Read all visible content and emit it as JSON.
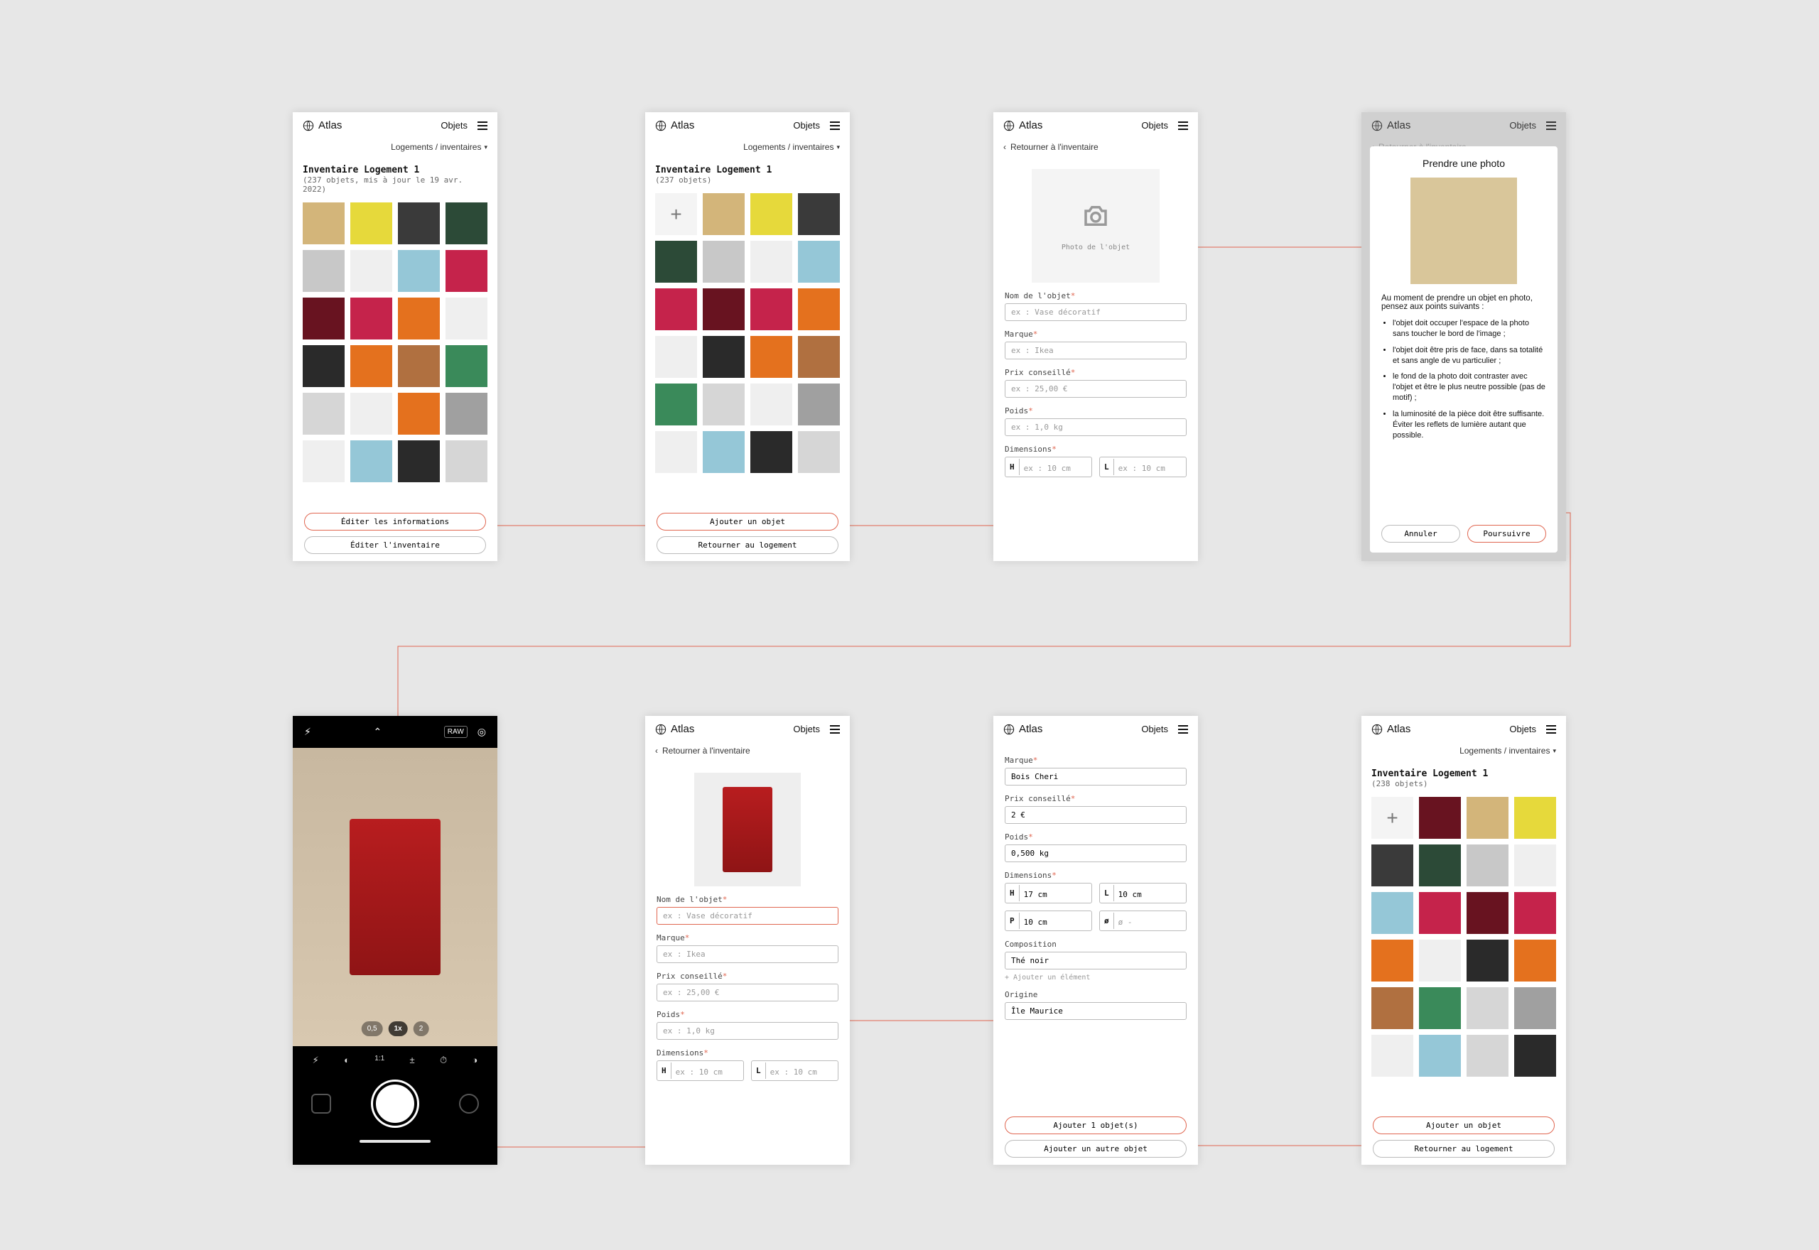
{
  "brand": "Atlas",
  "header": {
    "objets": "Objets",
    "breadcrumb": "Logements / inventaires",
    "breadcrumb_symbol": "▾"
  },
  "back_label": "Retourner à l'inventaire",
  "screen1": {
    "title": "Inventaire Logement 1",
    "subtitle": "(237 objets, mis à jour le 19 avr. 2022)",
    "btn_edit_info": "Éditer les informations",
    "btn_edit_inv": "Éditer l'inventaire"
  },
  "screen2": {
    "title": "Inventaire Logement 1",
    "subtitle": "(237 objets)",
    "btn_add": "Ajouter un objet",
    "btn_return": "Retourner au logement"
  },
  "form": {
    "photo_caption": "Photo de l'objet",
    "labels": {
      "nom": "Nom de l'objet",
      "marque": "Marque",
      "prix": "Prix conseillé",
      "poids": "Poids",
      "dimensions": "Dimensions",
      "composition": "Composition",
      "origine": "Origine"
    },
    "placeholders": {
      "nom": "ex : Vase décoratif",
      "marque": "ex : Ikea",
      "prix": "ex : 25,00 €",
      "poids": "ex : 1,0 kg",
      "dim_h": "ex : 10 cm",
      "dim_l": "ex : 10 cm",
      "diam": "ø -"
    },
    "dim_keys": {
      "H": "H",
      "L": "L",
      "P": "P"
    },
    "add_element": "+ Ajouter un élément"
  },
  "modal": {
    "title": "Prendre une photo",
    "intro": "Au moment de prendre un objet en photo, pensez aux points suivants :",
    "bullets": [
      "l'objet doit occuper l'espace de la photo sans toucher le bord de l'image ;",
      "l'objet doit être pris de face, dans sa totalité et sans angle de vu particulier ;",
      "le fond de la photo doit contraster avec l'objet et être le plus neutre possible (pas de motif) ;",
      "la luminosité de la pièce doit être suffisante. Éviter les reflets de lumière autant que possible."
    ],
    "cancel": "Annuler",
    "proceed": "Poursuivre"
  },
  "camera": {
    "zoom": [
      "0,5",
      "1x",
      "2"
    ],
    "badge": "RAW"
  },
  "screen7": {
    "values": {
      "marque": "Bois Cheri",
      "prix": "2 €",
      "poids": "0,500 kg",
      "h": "17 cm",
      "l": "10 cm",
      "p": "10 cm",
      "composition": "Thé noir",
      "origine": "Île Maurice"
    },
    "btn_add_one": "Ajouter 1 objet(s)",
    "btn_add_other": "Ajouter un autre objet"
  },
  "screen8": {
    "title": "Inventaire Logement 1",
    "subtitle": "(238 objets)",
    "btn_add": "Ajouter un objet",
    "btn_return": "Retourner au logement"
  }
}
